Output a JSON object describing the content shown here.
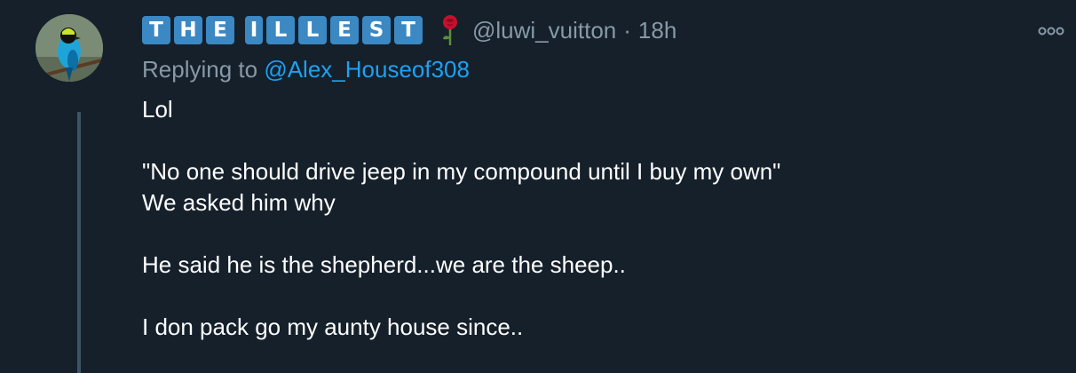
{
  "tweet": {
    "display_name_letters": [
      "T",
      "H",
      "E",
      " ",
      "I",
      "L",
      "L",
      "E",
      "S",
      "T"
    ],
    "handle": "@luwi_vuitton",
    "separator": "·",
    "time": "18h",
    "reply_prefix": "Replying to",
    "reply_to": "@Alex_Houseof308",
    "body": [
      [
        "Lol"
      ],
      [
        "\"No one should drive jeep in my compound until I buy my own\"",
        "We asked him why"
      ],
      [
        "He said he is the shepherd...we are the sheep.."
      ],
      [
        "I don pack go my aunty house since.."
      ]
    ]
  },
  "icons": {
    "avatar": "bird-avatar-icon",
    "rose": "rose-icon",
    "more": "more-options-icon"
  },
  "colors": {
    "background": "#15202b",
    "text": "#ffffff",
    "muted": "#8899a6",
    "link": "#1da1f2",
    "letter_box": "#3b88c3",
    "thread_line": "#3d5466"
  }
}
